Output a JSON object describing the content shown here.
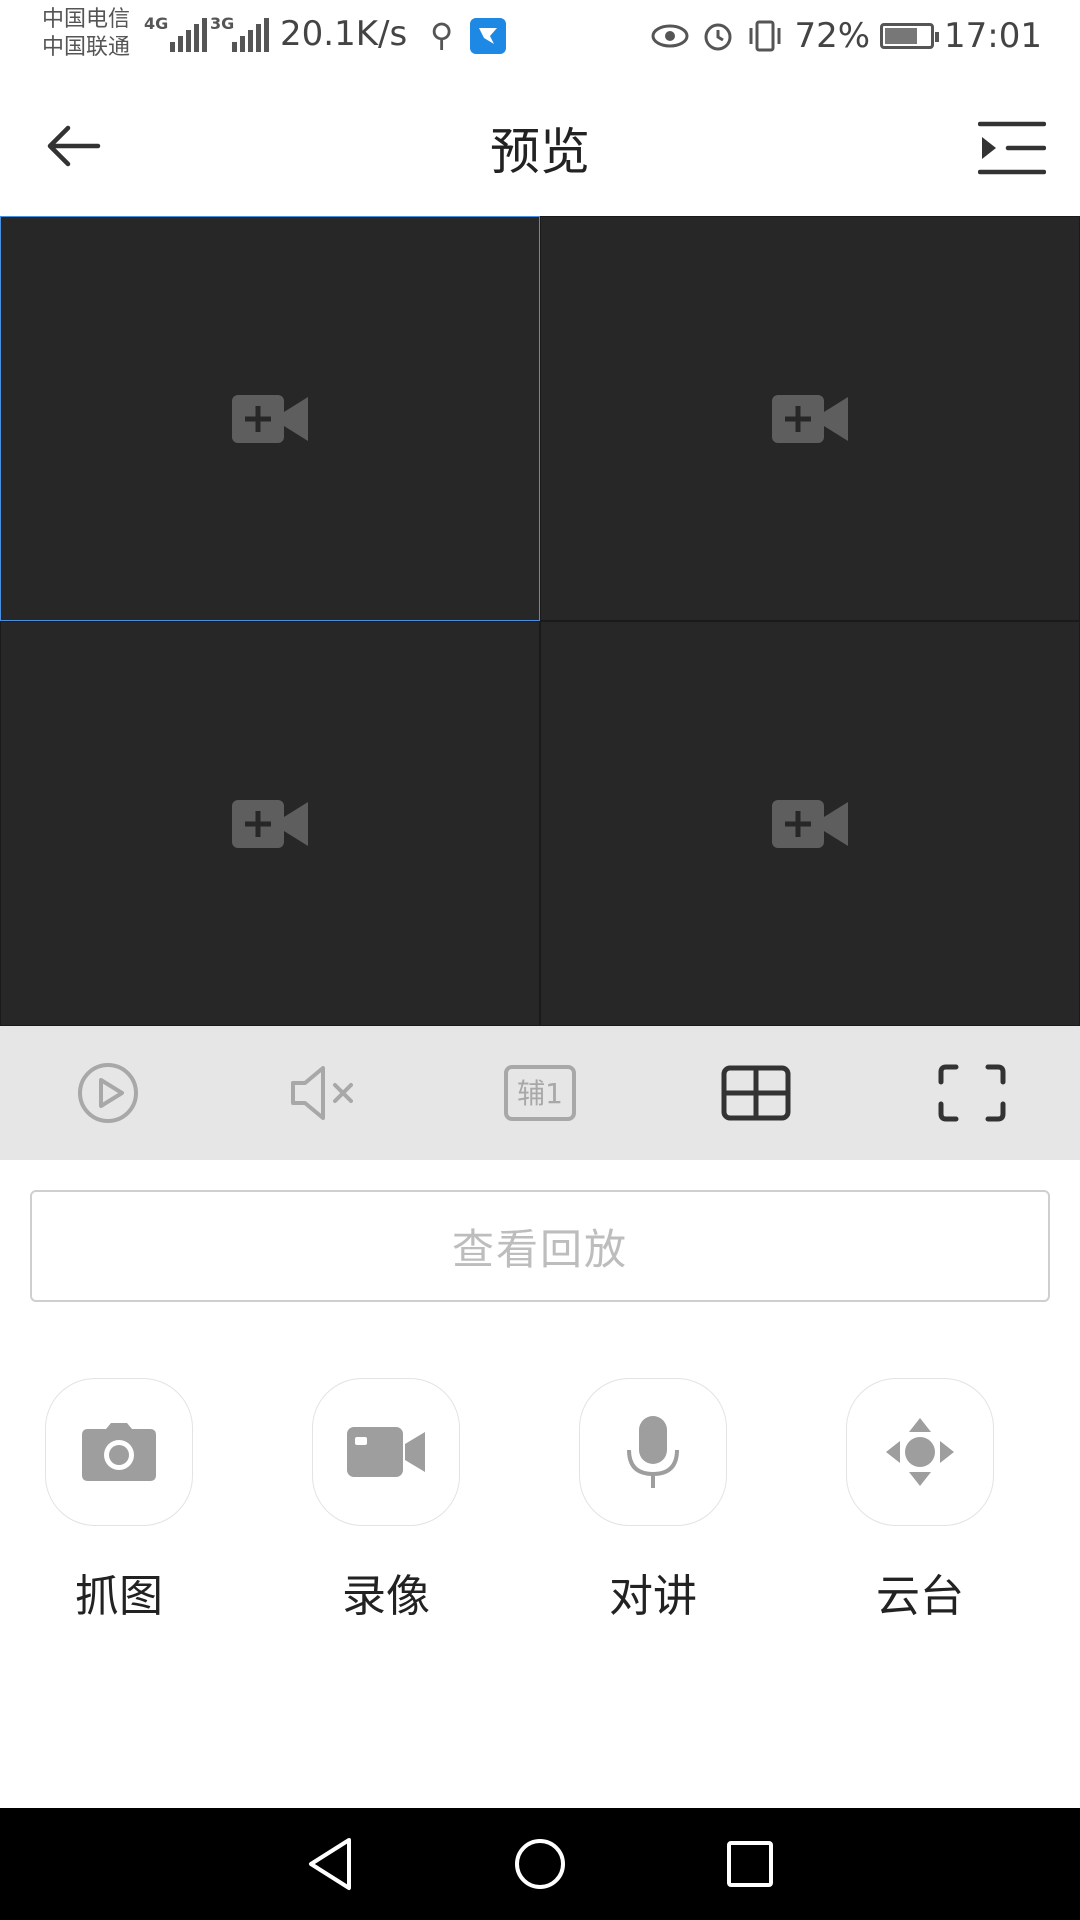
{
  "status_bar": {
    "carrier_1": "中国电信",
    "carrier_2": "中国联通",
    "net_1": "4G",
    "net_2": "3G",
    "speed": "20.1K/s",
    "battery": "72%",
    "battery_level": 0.72,
    "time": "17:01"
  },
  "header": {
    "title": "预览"
  },
  "preview_grid": {
    "cells": [
      {
        "id": 1,
        "selected": true
      },
      {
        "id": 2,
        "selected": false
      },
      {
        "id": 3,
        "selected": false
      },
      {
        "id": 4,
        "selected": false
      }
    ]
  },
  "playback": {
    "label": "查看回放"
  },
  "toolbar": {
    "aux_label": "辅1"
  },
  "actions": [
    {
      "label": "抓图",
      "icon": "camera-icon"
    },
    {
      "label": "录像",
      "icon": "video-camera-icon"
    },
    {
      "label": "对讲",
      "icon": "microphone-icon"
    },
    {
      "label": "云台",
      "icon": "ptz-direction-icon"
    }
  ],
  "colors": {
    "accent": "#4a90e2",
    "video_bg": "#272727",
    "toolbar_bg": "#e6e6e6",
    "icon_gray": "#9e9e9e"
  }
}
